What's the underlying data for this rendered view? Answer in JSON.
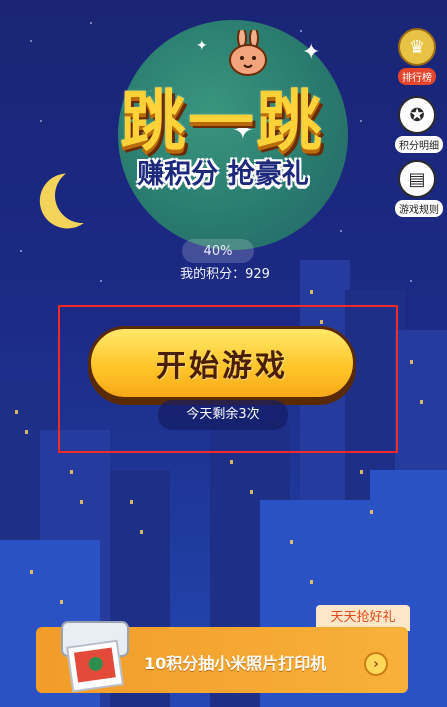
{
  "logo": {
    "title": "跳一跳",
    "subtitle": "赚积分 抢豪礼"
  },
  "side_menu": [
    {
      "label": "排行榜",
      "icon": "trophy-icon"
    },
    {
      "label": "积分明细",
      "icon": "star-badge-icon"
    },
    {
      "label": "游戏规则",
      "icon": "rules-icon"
    }
  ],
  "progress": {
    "percent_text": "40%",
    "value": 0.4
  },
  "score": {
    "text": "我的积分：929"
  },
  "start": {
    "label": "开始游戏",
    "remaining": "今天剩余3次"
  },
  "banner": {
    "tag": "天天抢好礼",
    "text": "10积分抽小米照片打印机",
    "arrow": "›"
  },
  "colors": {
    "background": "#1b2477",
    "accent_gold": "#ffc62b",
    "highlight_red": "#f02a2a",
    "banner_orange": "#f29c2a"
  }
}
